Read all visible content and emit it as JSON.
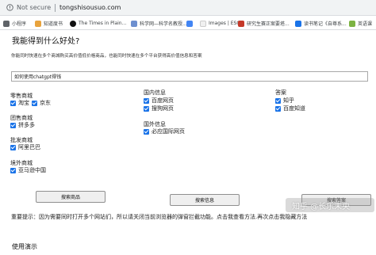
{
  "browser": {
    "security_label": "Not secure",
    "url": "tongshisousuo.com",
    "warning_color": "#5f6368"
  },
  "bookmarks": [
    {
      "label": "小程序",
      "color": "#5f6368"
    },
    {
      "label": "知道度书",
      "color": "#e8a33d"
    },
    {
      "label": "The Times in Plain...",
      "color": "#111111"
    },
    {
      "label": "科学网—科学名教授...",
      "color": "#6d8fcf"
    },
    {
      "label": "",
      "color": "#4285f4"
    },
    {
      "label": "Images | ESO",
      "color": "#f0f0f0"
    },
    {
      "label": "研究生赛正案要塔...",
      "color": "#c53929"
    },
    {
      "label": "读书笔记《自尊系...",
      "color": "#1a73e8"
    },
    {
      "label": "英语课",
      "color": "#7cb342"
    }
  ],
  "page": {
    "title": "我能得到什么好处?",
    "description": "你能同时快速在多个商城购买高价值低价格商品，也能同时快速在多个平台获得高价值信息和答案",
    "search_value": "如何使用chatgpt得钱",
    "groups": {
      "retail": {
        "title": "零售商城",
        "options": [
          "淘宝",
          "京东"
        ]
      },
      "group_buy": {
        "title": "团售商城",
        "options": [
          "拼多多"
        ]
      },
      "wholesale": {
        "title": "批发商城",
        "options": [
          "阿里巴巴"
        ]
      },
      "overseas": {
        "title": "境外商城",
        "options": [
          "亚马逊中国"
        ]
      },
      "domestic_info": {
        "title": "国内信息",
        "options": [
          "百度网页",
          "搜狗网页"
        ]
      },
      "foreign_info": {
        "title": "国外信息",
        "options": [
          "必应国际网页"
        ]
      },
      "answers": {
        "title": "答案",
        "options": [
          "知乎",
          "百度知道"
        ]
      }
    },
    "buttons": {
      "search_products": "搜索商品",
      "search_info": "搜索信息",
      "search_answers": "搜索答案"
    },
    "notice": "重要提示：因为需要同时打开多个网站们，所以请关闭当前浏览器的弹窗拦截功能。点击我查看方法.再次点击我隐藏方法",
    "usage_title": "使用演示",
    "watermark": "知乎 @长乐未央",
    "checkbox_color": "#1a73e8"
  }
}
